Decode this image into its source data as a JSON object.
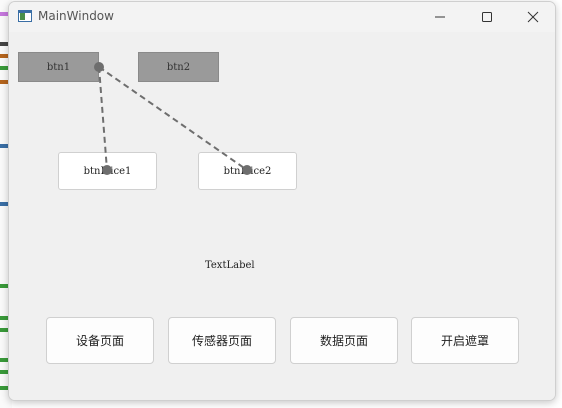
{
  "window": {
    "title": "MainWindow"
  },
  "buttons": {
    "btn1": "btn1",
    "btn2": "btn2",
    "slice1": "btnL ice1",
    "slice2": "btnL ice2"
  },
  "label": {
    "text": "TextLabel"
  },
  "page_buttons": [
    {
      "label": "设备页面"
    },
    {
      "label": "传感器页面"
    },
    {
      "label": "数据页面"
    },
    {
      "label": "开启遮罩"
    }
  ],
  "colors": {
    "flat_button": "#9a9a9a",
    "connector": "#6e6e6e",
    "window_bg": "#f0f0f0"
  },
  "icons": {
    "app": "qt-window-icon",
    "minimize": "minimize-icon",
    "maximize": "maximize-icon",
    "close": "close-icon"
  }
}
